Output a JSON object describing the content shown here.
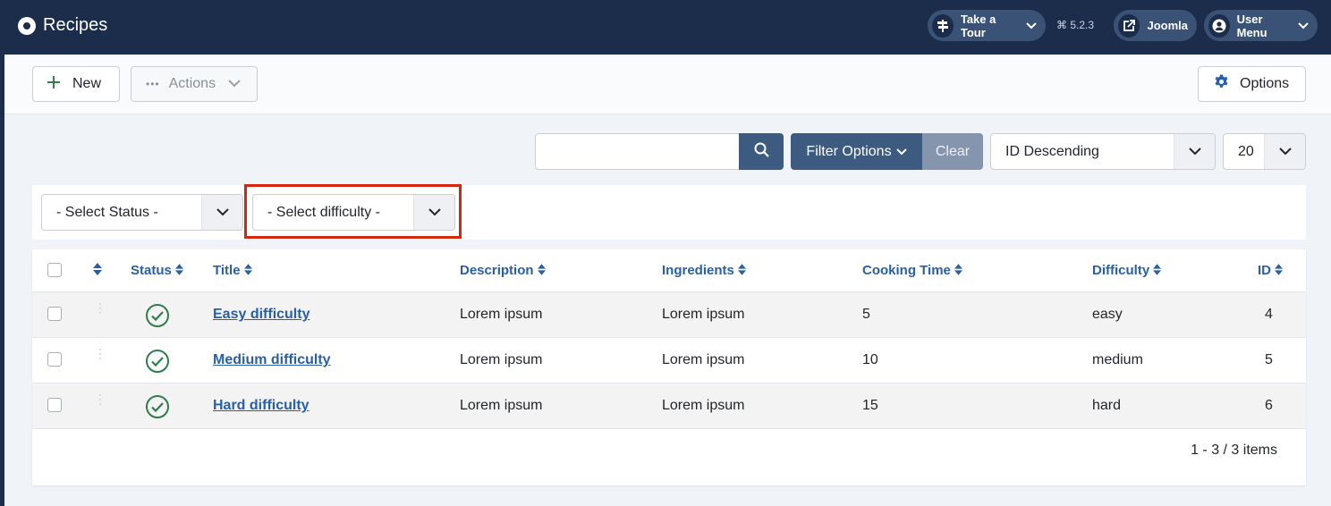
{
  "header": {
    "title": "Recipes",
    "tour_label": "Take a Tour",
    "version": "5.2.3",
    "joomla_label": "Joomla",
    "user_menu_label": "User Menu"
  },
  "toolbar": {
    "new_label": "New",
    "actions_label": "Actions",
    "options_label": "Options"
  },
  "search": {
    "value": "",
    "filter_options_label": "Filter Options",
    "clear_label": "Clear",
    "sort_value": "ID Descending",
    "limit_value": "20"
  },
  "filters": {
    "status_value": "- Select Status -",
    "difficulty_value": "- Select difficulty -"
  },
  "table": {
    "columns": [
      "Status",
      "Title",
      "Description",
      "Ingredients",
      "Cooking Time",
      "Difficulty",
      "ID"
    ],
    "rows": [
      {
        "title": "Easy difficulty",
        "description": "Lorem ipsum",
        "ingredients": "Lorem ipsum",
        "cooking_time": "5",
        "difficulty": "easy",
        "id": "4"
      },
      {
        "title": "Medium difficulty",
        "description": "Lorem ipsum",
        "ingredients": "Lorem ipsum",
        "cooking_time": "10",
        "difficulty": "medium",
        "id": "5"
      },
      {
        "title": "Hard difficulty",
        "description": "Lorem ipsum",
        "ingredients": "Lorem ipsum",
        "cooking_time": "15",
        "difficulty": "hard",
        "id": "6"
      }
    ],
    "footer": "1 - 3 / 3 items"
  },
  "colors": {
    "header_bg": "#1c2c4b",
    "link": "#2a5fa5",
    "published": "#2f7d4b",
    "highlight": "#d7260e"
  }
}
